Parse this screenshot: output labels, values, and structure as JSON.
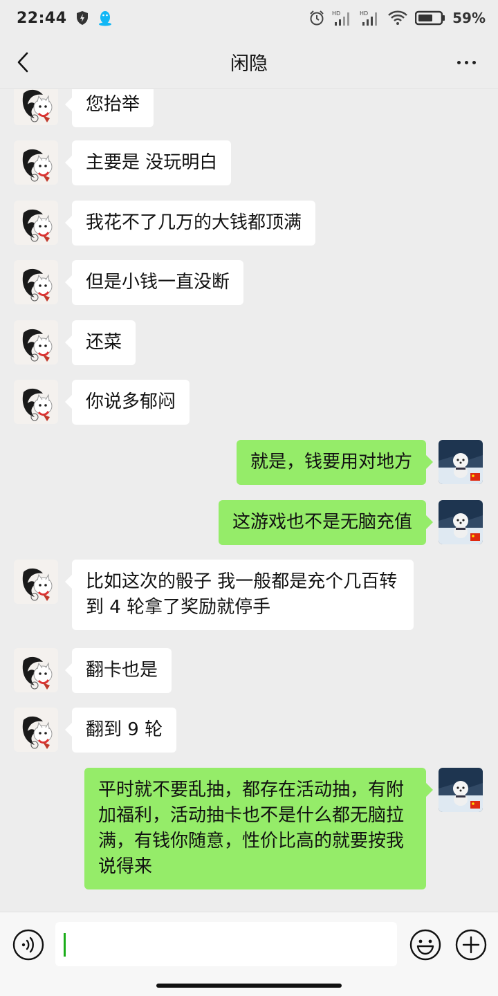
{
  "status_bar": {
    "time": "22:44",
    "battery": "59%",
    "icons": [
      "shield-bolt-icon",
      "qq-penguin-icon",
      "alarm-icon",
      "hd-signal-icon",
      "hd-signal-icon",
      "wifi-icon",
      "battery-icon"
    ]
  },
  "header": {
    "title": "闲隐",
    "back_icon": "chevron-left-icon",
    "more_icon": "more-dots-icon"
  },
  "messages": [
    {
      "side": "in",
      "text": "您抬举"
    },
    {
      "side": "in",
      "text": "主要是 没玩明白"
    },
    {
      "side": "in",
      "text": "我花不了几万的大钱都顶满"
    },
    {
      "side": "in",
      "text": "但是小钱一直没断"
    },
    {
      "side": "in",
      "text": "还菜"
    },
    {
      "side": "in",
      "text": "你说多郁闷"
    },
    {
      "side": "out",
      "text": "就是，钱要用对地方"
    },
    {
      "side": "out",
      "text": "这游戏也不是无脑充值"
    },
    {
      "side": "in",
      "text": "比如这次的骰子 我一般都是充个几百转到 4 轮拿了奖励就停手"
    },
    {
      "side": "in",
      "text": "翻卡也是"
    },
    {
      "side": "in",
      "text": "翻到 9 轮"
    },
    {
      "side": "out",
      "text": "平时就不要乱抽，都存在活动抽，有附加福利，活动抽卡也不是什么都无脑拉满，有钱你随意，性价比高的就要按我说得来"
    }
  ],
  "input_bar": {
    "value": "",
    "voice_icon": "voice-icon",
    "emoji_icon": "emoji-icon",
    "plus_icon": "plus-icon"
  },
  "colors": {
    "background": "#ededed",
    "incoming_bubble": "#ffffff",
    "outgoing_bubble": "#95ec69",
    "input_bar": "#f7f7f7",
    "caret": "#1aad19"
  }
}
